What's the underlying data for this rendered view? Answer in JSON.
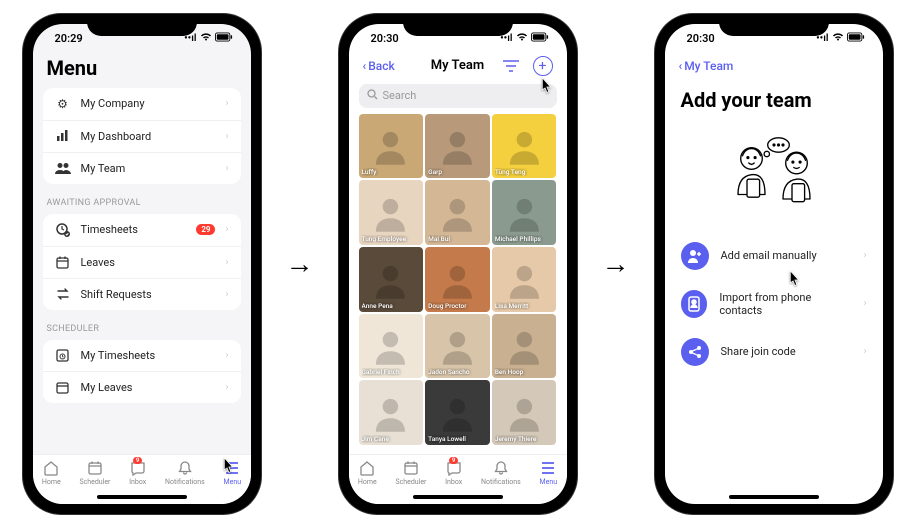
{
  "colors": {
    "accent": "#5b5fef",
    "badge": "#ff3b30"
  },
  "tabs": [
    {
      "key": "home",
      "label": "Home"
    },
    {
      "key": "scheduler",
      "label": "Scheduler"
    },
    {
      "key": "inbox",
      "label": "Inbox",
      "badge": "9"
    },
    {
      "key": "notifications",
      "label": "Notifications"
    },
    {
      "key": "menu",
      "label": "Menu"
    }
  ],
  "screen1": {
    "time": "20:29",
    "title": "Menu",
    "sections": [
      {
        "items": [
          {
            "icon": "gear-icon",
            "label": "My Company"
          },
          {
            "icon": "chart-icon",
            "label": "My Dashboard"
          },
          {
            "icon": "people-icon",
            "label": "My Team"
          }
        ]
      },
      {
        "heading": "AWAITING APPROVAL",
        "items": [
          {
            "icon": "clock-check-icon",
            "label": "Timesheets",
            "badge": "29"
          },
          {
            "icon": "calendar-icon",
            "label": "Leaves"
          },
          {
            "icon": "swap-icon",
            "label": "Shift Requests"
          }
        ]
      },
      {
        "heading": "SCHEDULER",
        "items": [
          {
            "icon": "timesheet-icon",
            "label": "My Timesheets"
          },
          {
            "icon": "calendar-icon",
            "label": "My Leaves"
          }
        ]
      }
    ]
  },
  "screen2": {
    "time": "20:30",
    "back": "Back",
    "title": "My Team",
    "search_placeholder": "Search",
    "members": [
      {
        "name": "Luffy",
        "bg": "#c9a876"
      },
      {
        "name": "Garp",
        "bg": "#b89a7a"
      },
      {
        "name": "Tùng Teng",
        "bg": "#f4d03f"
      },
      {
        "name": "Tung Employee",
        "bg": "#e8d5c0"
      },
      {
        "name": "Mai Bui",
        "bg": "#d4b896"
      },
      {
        "name": "Michael Phillips",
        "bg": "#8a9a8e"
      },
      {
        "name": "Anne Pena",
        "bg": "#5a4a3a"
      },
      {
        "name": "Doug Proctor",
        "bg": "#c47a4a"
      },
      {
        "name": "Lisa Merritt",
        "bg": "#e5c9a8"
      },
      {
        "name": "Gabriel Finch",
        "bg": "#f0e6d8"
      },
      {
        "name": "Jadon Sancho",
        "bg": "#d8c4a8"
      },
      {
        "name": "Ben Hoop",
        "bg": "#c8b090"
      },
      {
        "name": "Jim Cane",
        "bg": "#e8e0d4"
      },
      {
        "name": "Tanya Lowell",
        "bg": "#3a3a3a"
      },
      {
        "name": "Jeremy Thiere",
        "bg": "#d4c8b8"
      }
    ]
  },
  "screen3": {
    "time": "20:30",
    "back": "My Team",
    "title": "Add your team",
    "options": [
      {
        "icon": "person-plus-icon",
        "label": "Add email manually"
      },
      {
        "icon": "contacts-icon",
        "label": "Import from phone contacts"
      },
      {
        "icon": "share-icon",
        "label": "Share join code"
      }
    ]
  }
}
